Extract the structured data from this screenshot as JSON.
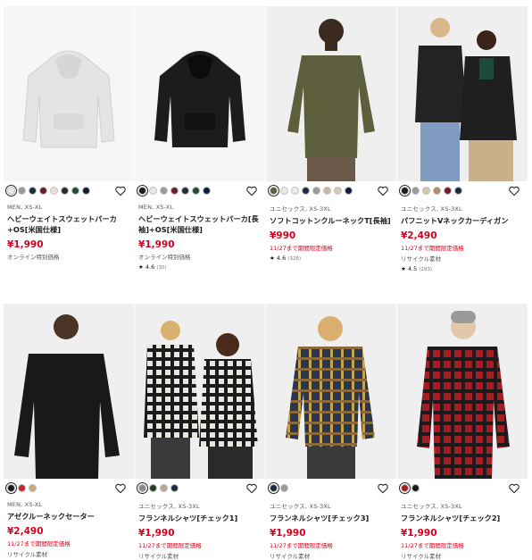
{
  "products": [
    {
      "gender": "MEN, XS-XL",
      "name": "ヘビーウェイトスウェットパーカ+OS[米国仕様]",
      "price": "¥1,990",
      "promo": "",
      "note": "オンライン特別価格",
      "rating": "",
      "review_count": "",
      "swatches": [
        "#e8e8e8",
        "#9a9a9a",
        "#1f2a44",
        "#6b1f2a",
        "#e9e3d6",
        "#2b2b2b",
        "#1e4d3a",
        "#0f1b3a"
      ],
      "image": "hoodie-gray"
    },
    {
      "gender": "MEN, XS-XL",
      "name": "ヘビーウェイトスウェットパーカ[長袖]+OS[米国仕様]",
      "price": "¥1,990",
      "promo": "",
      "note": "オンライン特別価格",
      "rating": "★ 4.6",
      "review_count": "(30)",
      "swatches": [
        "#1b1b1b",
        "#e8e8e8",
        "#9a9a9a",
        "#6b1f2a",
        "#1f2a44",
        "#1e4d3a",
        "#0f1b3a"
      ],
      "image": "hoodie-black"
    },
    {
      "gender": "ユニセックス, XS-3XL",
      "name": "ソフトコットンクルーネックT[長袖]",
      "price": "¥990",
      "promo": "11/27まで期間限定価格",
      "note": "",
      "rating": "★ 4.6",
      "review_count": "(326)",
      "swatches": [
        "#5d5e3c",
        "#e8e8e8",
        "#ececec",
        "#1f2a44",
        "#9a9a9a",
        "#cdb8a6",
        "#d9c9b6",
        "#0f1b3a"
      ],
      "image": "olive-tee"
    },
    {
      "gender": "ユニセックス, XS-3XL",
      "name": "パフニットVネックカーディガン",
      "price": "¥2,490",
      "promo": "11/27まで期間限定価格",
      "note": "リサイクル素材",
      "rating": "★ 4.5",
      "review_count": "(293)",
      "swatches": [
        "#1b1b1b",
        "#9a9a9a",
        "#d8c8a8",
        "#b08a6a",
        "#6b1f2a",
        "#1f2a44"
      ],
      "image": "cardigan"
    },
    {
      "gender": "MEN, XS-XL",
      "name": "アゼクルーネックセーター",
      "price": "¥2,490",
      "promo": "11/27まで期間限定価格",
      "note": "リサイクル素材",
      "rating": "",
      "review_count": "",
      "swatches": [
        "#1b1b1b",
        "#c0282c",
        "#c9a982"
      ],
      "image": "sweater-black"
    },
    {
      "gender": "ユニセックス, XS-3XL",
      "name": "フランネルシャツ[チェック1]",
      "price": "¥1,990",
      "promo": "11/27まで期間限定価格",
      "note": "リサイクル素材",
      "rating": "",
      "review_count": "",
      "swatches": [
        "#8a8a8a",
        "#2b3a2b",
        "#b8a890",
        "#1f2a44"
      ],
      "image": "flannel-bw"
    },
    {
      "gender": "ユニセックス, XS-3XL",
      "name": "フランネルシャツ[チェック3]",
      "price": "¥1,990",
      "promo": "11/27まで期間限定価格",
      "note": "リサイクル素材",
      "rating": "",
      "review_count": "",
      "swatches": [
        "#1f2a44",
        "#9a9a9a"
      ],
      "image": "flannel-navy"
    },
    {
      "gender": "ユニセックス, XS-3XL",
      "name": "フランネルシャツ[チェック2]",
      "price": "¥1,990",
      "promo": "11/27まで期間限定価格",
      "note": "リサイクル素材",
      "rating": "",
      "review_count": "",
      "swatches": [
        "#a61e25",
        "#1b1b1b"
      ],
      "image": "flannel-red"
    }
  ],
  "icons": {
    "favorite": "heart-outline-icon"
  },
  "colors": {
    "price_red": "#d6001c",
    "text": "#1b1b1b"
  }
}
